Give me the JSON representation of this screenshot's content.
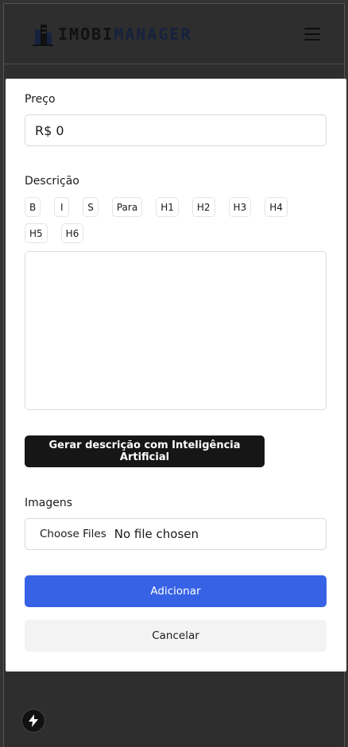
{
  "header": {
    "logo_part1": "IMOBI",
    "logo_part2": "MANAGER",
    "menu_icon": "hamburger-icon"
  },
  "form": {
    "price": {
      "label": "Preço",
      "value": "R$ 0"
    },
    "description": {
      "label": "Descrição",
      "toolbar": [
        "B",
        "I",
        "S",
        "Para",
        "H1",
        "H2",
        "H3",
        "H4",
        "H5",
        "H6"
      ],
      "content": ""
    },
    "ai_button_label": "Gerar descrição com Inteligência Artificial",
    "images": {
      "label": "Imagens",
      "choose_label": "Choose Files",
      "status": "No file chosen"
    },
    "submit_label": "Adicionar",
    "cancel_label": "Cancelar"
  },
  "colors": {
    "primary": "#3762e6",
    "dark_button": "#161616",
    "overlay": "#333333"
  },
  "fab_icon": "lightning-icon"
}
